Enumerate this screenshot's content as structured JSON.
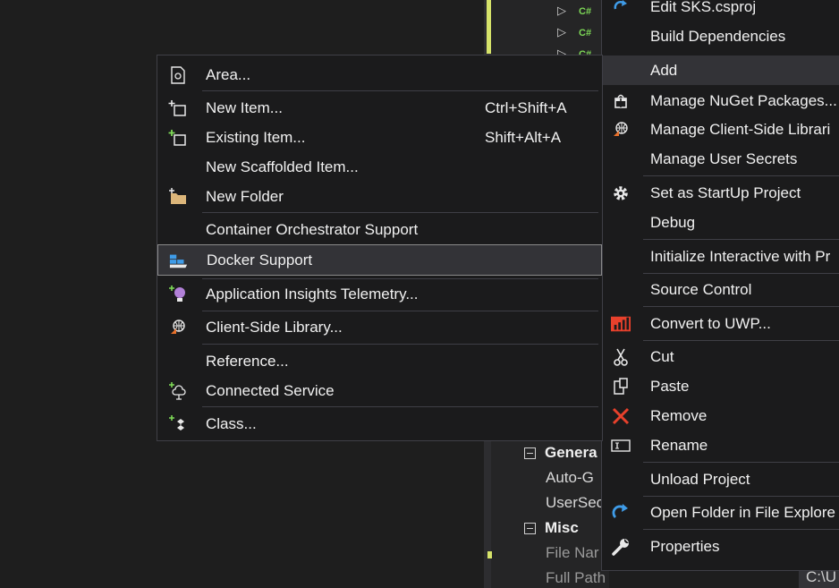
{
  "solution_explorer": {
    "rows": [
      {
        "caret": "▷",
        "tag": "C#"
      },
      {
        "caret": "▷",
        "tag": "C#"
      },
      {
        "caret": "▷",
        "tag": "C#"
      }
    ]
  },
  "properties": {
    "rows": [
      {
        "label": "Genera",
        "kind": "cat"
      },
      {
        "label": "Auto-G",
        "kind": "child"
      },
      {
        "label": "UserSec",
        "kind": "child"
      },
      {
        "label": "Misc",
        "kind": "cat"
      },
      {
        "label": "File Nar",
        "kind": "child-dim"
      },
      {
        "label": "Full Path",
        "kind": "child-dim"
      }
    ],
    "full_path_value": "C:\\U"
  },
  "context_menu": {
    "items": [
      {
        "label": "Edit SKS.csproj",
        "icon": "edit-icon"
      },
      {
        "label": "Build Dependencies",
        "icon": ""
      },
      {
        "label": "Add",
        "icon": "",
        "active": true
      },
      {
        "label": "Manage NuGet Packages...",
        "icon": "nuget-icon"
      },
      {
        "label": "Manage Client-Side Librari",
        "icon": "client-library-icon"
      },
      {
        "label": "Manage User Secrets",
        "icon": ""
      },
      {
        "label": "Set as StartUp Project",
        "icon": "gear-icon"
      },
      {
        "label": "Debug",
        "icon": ""
      },
      {
        "label": "Initialize Interactive with Pr",
        "icon": ""
      },
      {
        "label": "Source Control",
        "icon": ""
      },
      {
        "label": "Convert to UWP...",
        "icon": "uwp-icon"
      },
      {
        "label": "Cut",
        "icon": "scissors-icon"
      },
      {
        "label": "Paste",
        "icon": "paste-icon"
      },
      {
        "label": "Remove",
        "icon": "remove-x-icon"
      },
      {
        "label": "Rename",
        "icon": "rename-icon"
      },
      {
        "label": "Unload Project",
        "icon": ""
      },
      {
        "label": "Open Folder in File Explore",
        "icon": "open-folder-arrow-icon"
      },
      {
        "label": "Properties",
        "icon": "wrench-icon"
      }
    ]
  },
  "add_submenu": {
    "items": [
      {
        "label": "Area...",
        "shortcut": "",
        "icon": "area-icon"
      },
      {
        "label": "New Item...",
        "shortcut": "Ctrl+Shift+A",
        "icon": "new-item-icon"
      },
      {
        "label": "Existing Item...",
        "shortcut": "Shift+Alt+A",
        "icon": "existing-item-icon"
      },
      {
        "label": "New Scaffolded Item...",
        "shortcut": "",
        "icon": ""
      },
      {
        "label": "New Folder",
        "shortcut": "",
        "icon": "new-folder-icon"
      },
      {
        "label": "Container Orchestrator Support",
        "shortcut": "",
        "icon": ""
      },
      {
        "label": "Docker Support",
        "shortcut": "",
        "icon": "docker-icon",
        "hover": true
      },
      {
        "label": "Application Insights Telemetry...",
        "shortcut": "",
        "icon": "insights-bulb-icon"
      },
      {
        "label": "Client-Side Library...",
        "shortcut": "",
        "icon": "client-library-icon"
      },
      {
        "label": "Reference...",
        "shortcut": "",
        "icon": ""
      },
      {
        "label": "Connected Service",
        "shortcut": "",
        "icon": "connected-service-icon"
      },
      {
        "label": "Class...",
        "shortcut": "",
        "icon": "class-icon"
      }
    ]
  },
  "colors": {
    "menu_bg": "#1b1b1c",
    "menu_border": "#3f3f46",
    "hover_bg": "#333337",
    "accent_green": "#7ed957",
    "remove_red": "#e8412c",
    "uwp_red": "#e8412c",
    "folder_tan": "#dcb67a",
    "arrow_blue": "#3f9ce8"
  }
}
